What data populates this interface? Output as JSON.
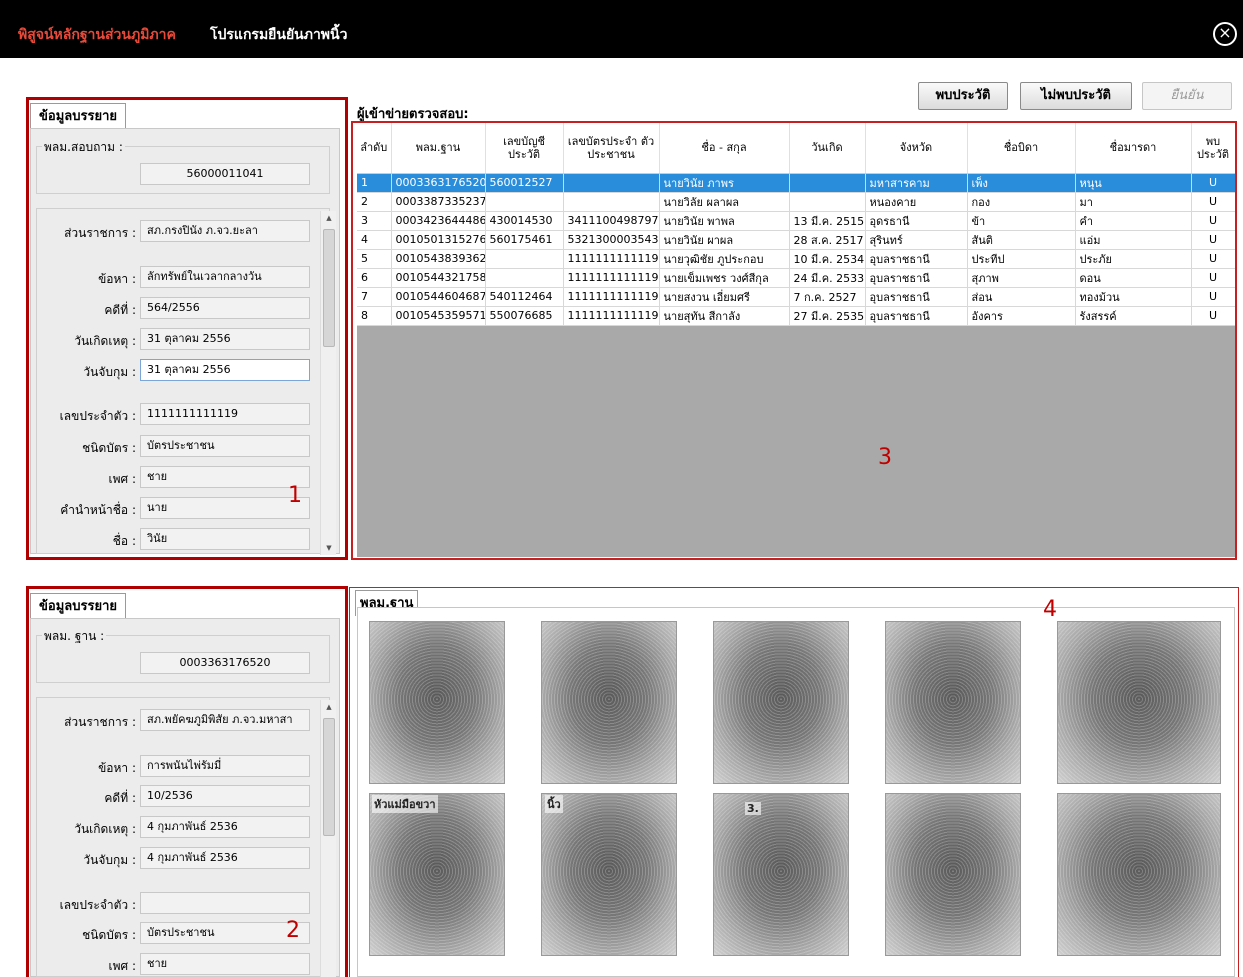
{
  "title": {
    "red": "พิสูจน์หลักฐานส่วนภูมิภาค",
    "white": "โปรแกรมยืนยันภาพนิ้ว"
  },
  "buttons": {
    "found": "พบประวัติ",
    "not_found": "ไม่พบประวัติ",
    "confirm": "ยืนยัน"
  },
  "panel1": {
    "tab": "ข้อมูลบรรยาย",
    "group_label": "พลม.สอบถาม :",
    "group_value": "56000011041",
    "fields": [
      {
        "label": "ส่วนราชการ :",
        "value": "สภ.กรงปินัง ภ.จว.ยะลา"
      },
      {
        "label": "ข้อหา :",
        "value": "ลักทรัพย์ในเวลากลางวัน"
      },
      {
        "label": "คดีที่ :",
        "value": "564/2556"
      },
      {
        "label": "วันเกิดเหตุ :",
        "value": "31 ตุลาคม 2556"
      },
      {
        "label": "วันจับกุม :",
        "value": "31 ตุลาคม 2556"
      },
      {
        "label": "เลขประจำตัว :",
        "value": "1111111111119"
      },
      {
        "label": "ชนิดบัตร :",
        "value": "บัตรประชาชน"
      },
      {
        "label": "เพศ :",
        "value": "ชาย"
      },
      {
        "label": "คำนำหน้าชื่อ :",
        "value": "นาย"
      },
      {
        "label": "ชื่อ :",
        "value": "วินัย"
      }
    ]
  },
  "panel2": {
    "tab": "ข้อมูลบรรยาย",
    "group_label": "พลม. ฐาน :",
    "group_value": "0003363176520",
    "fields": [
      {
        "label": "ส่วนราชการ :",
        "value": "สภ.พยัคฆภูมิพิสัย ภ.จว.มหาสา"
      },
      {
        "label": "ข้อหา :",
        "value": "การพนันไพ่รัมมี่"
      },
      {
        "label": "คดีที่ :",
        "value": "10/2536"
      },
      {
        "label": "วันเกิดเหตุ :",
        "value": "4 กุมภาพันธ์ 2536"
      },
      {
        "label": "วันจับกุม :",
        "value": "4 กุมภาพันธ์ 2536"
      },
      {
        "label": "เลขประจำตัว :",
        "value": ""
      },
      {
        "label": "ชนิดบัตร :",
        "value": "บัตรประชาชน"
      },
      {
        "label": "เพศ :",
        "value": "ชาย"
      }
    ]
  },
  "grid": {
    "title": "ผู้เข้าข่ายตรวจสอบ:",
    "columns": [
      "ลำดับ",
      "พลม.ฐาน",
      "เลขบัญชี ประวัติ",
      "เลขบัตรประจำ ตัวประชาชน",
      "ชื่อ - สกุล",
      "วันเกิด",
      "จังหวัด",
      "ชื่อบิดา",
      "ชื่อมารดา",
      "พบ ประวัติ"
    ],
    "rows": [
      [
        "1",
        "0003363176520",
        "560012527",
        "",
        "นายวินัย ภาพร",
        "",
        "มหาสารคาม",
        "เพ็ง",
        "หนุน",
        "U"
      ],
      [
        "2",
        "0003387335237",
        "",
        "",
        "นายวิลัย ผลาผล",
        "",
        "หนองคาย",
        "กอง",
        "มา",
        "U"
      ],
      [
        "3",
        "0003423644486",
        "430014530",
        "3411100498797",
        "นายวินัย พาพล",
        "13 มี.ค. 2515",
        "อุดรธานี",
        "ข้า",
        "คำ",
        "U"
      ],
      [
        "4",
        "0010501315276",
        "560175461",
        "5321300003543",
        "นายวินัย ผาผล",
        "28 ส.ค. 2517",
        "สุรินทร์",
        "สันติ",
        "แอ่ม",
        "U"
      ],
      [
        "5",
        "0010543839362",
        "",
        "1111111111119",
        "นายวุฒิชัย ภูประกอบ",
        "10 มี.ค. 2534",
        "อุบลราชธานี",
        "ประทีป",
        "ประภัย",
        "U"
      ],
      [
        "6",
        "0010544321758",
        "",
        "1111111111119",
        "นายเข็มเพชร วงศ์สีกุล",
        "24 มี.ค. 2533",
        "อุบลราชธานี",
        "สุภาพ",
        "ดอน",
        "U"
      ],
      [
        "7",
        "0010544604687",
        "540112464",
        "1111111111119",
        "นายสงวน เอี่ยมศรี",
        "7 ก.ค. 2527",
        "อุบลราชธานี",
        "ส่อน",
        "ทองม้วน",
        "U"
      ],
      [
        "8",
        "0010545359571",
        "550076685",
        "1111111111119",
        "นายสุทัน สีกาลัง",
        "27 มี.ค. 2535",
        "อุบลราชธานี",
        "อังคาร",
        "รังสรรค์",
        "U"
      ]
    ]
  },
  "fp_tab": "พลม.ฐาน",
  "fp_texts": [
    "หัวแม่มือขวา",
    "นิ้ว",
    "3."
  ],
  "markers": [
    "1",
    "2",
    "3",
    "4"
  ]
}
